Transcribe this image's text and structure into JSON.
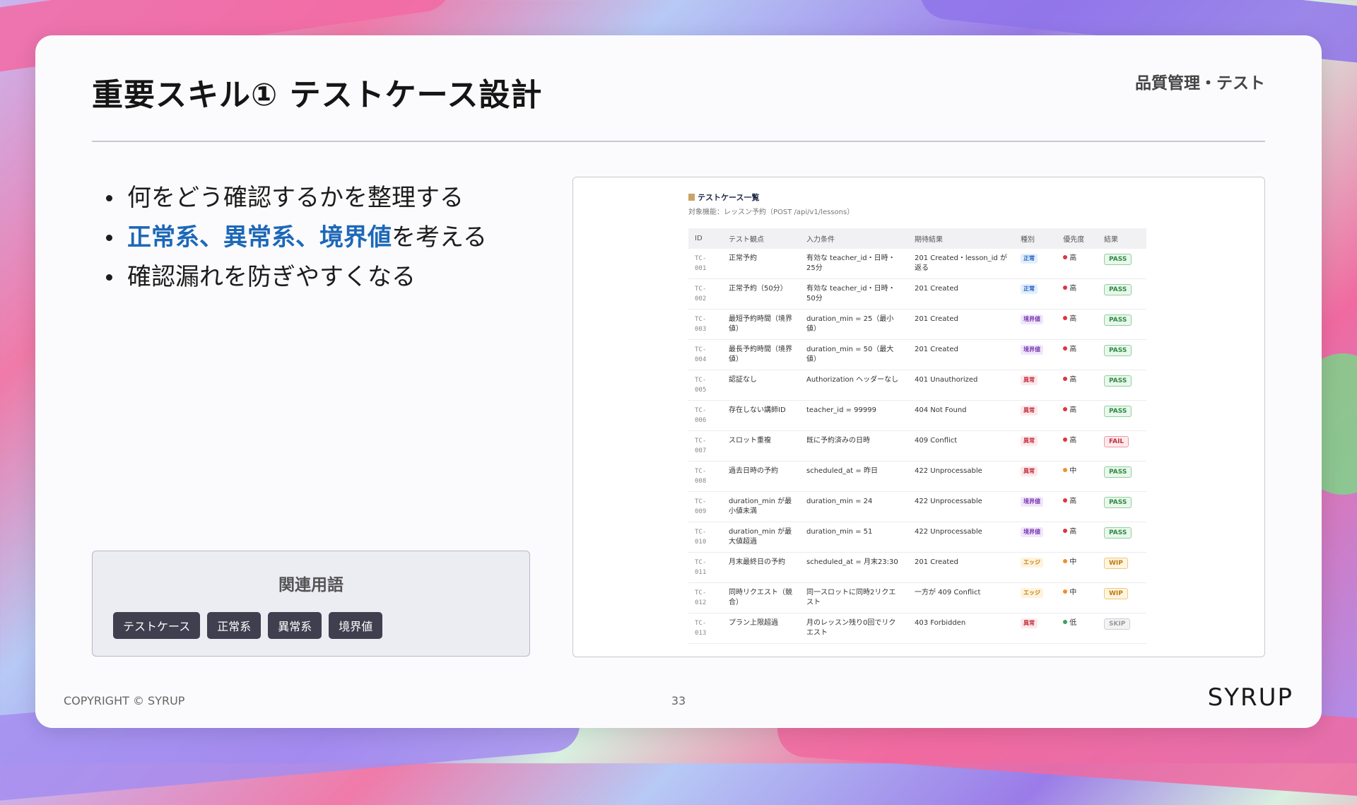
{
  "slide": {
    "title": "重要スキル① テストケース設計",
    "category": "品質管理・テスト",
    "bullets": [
      {
        "parts": [
          {
            "text": "何をどう確認するかを整理する",
            "hl": false
          }
        ]
      },
      {
        "parts": [
          {
            "text": "正常系、異常系、境界値",
            "hl": true
          },
          {
            "text": "を考える",
            "hl": false
          }
        ]
      },
      {
        "parts": [
          {
            "text": "確認漏れを防ぎやすくなる",
            "hl": false
          }
        ]
      }
    ],
    "related": {
      "title": "関連用語",
      "terms": [
        "テストケース",
        "正常系",
        "異常系",
        "境界値"
      ]
    },
    "footer": {
      "copyright": "COPYRIGHT © SYRUP",
      "page": "33",
      "logo": "SYRUP"
    }
  },
  "testcases": {
    "title": "テストケース一覧",
    "subtitle": "対象機能：レッスン予約（POST /api/v1/lessons）",
    "columns": [
      "ID",
      "テスト観点",
      "入力条件",
      "期待結果",
      "種別",
      "優先度",
      "結果"
    ],
    "rows": [
      {
        "id": "TC-001",
        "aspect": "正常予約",
        "input": "有効な teacher_id・日時・25分",
        "expected": "201 Created・lesson_id が返る",
        "type": "正常",
        "priority": "高",
        "result": "PASS"
      },
      {
        "id": "TC-002",
        "aspect": "正常予約（50分）",
        "input": "有効な teacher_id・日時・50分",
        "expected": "201 Created",
        "type": "正常",
        "priority": "高",
        "result": "PASS"
      },
      {
        "id": "TC-003",
        "aspect": "最短予約時間（境界値）",
        "input": "duration_min = 25（最小値）",
        "expected": "201 Created",
        "type": "境界値",
        "priority": "高",
        "result": "PASS"
      },
      {
        "id": "TC-004",
        "aspect": "最長予約時間（境界値）",
        "input": "duration_min = 50（最大値）",
        "expected": "201 Created",
        "type": "境界値",
        "priority": "高",
        "result": "PASS"
      },
      {
        "id": "TC-005",
        "aspect": "認証なし",
        "input": "Authorization ヘッダーなし",
        "expected": "401 Unauthorized",
        "type": "異常",
        "priority": "高",
        "result": "PASS"
      },
      {
        "id": "TC-006",
        "aspect": "存在しない講師ID",
        "input": "teacher_id = 99999",
        "expected": "404 Not Found",
        "type": "異常",
        "priority": "高",
        "result": "PASS"
      },
      {
        "id": "TC-007",
        "aspect": "スロット重複",
        "input": "既に予約済みの日時",
        "expected": "409 Conflict",
        "type": "異常",
        "priority": "高",
        "result": "FAIL"
      },
      {
        "id": "TC-008",
        "aspect": "過去日時の予約",
        "input": "scheduled_at = 昨日",
        "expected": "422 Unprocessable",
        "type": "異常",
        "priority": "中",
        "result": "PASS"
      },
      {
        "id": "TC-009",
        "aspect": "duration_min が最小値未満",
        "input": "duration_min = 24",
        "expected": "422 Unprocessable",
        "type": "境界値",
        "priority": "高",
        "result": "PASS"
      },
      {
        "id": "TC-010",
        "aspect": "duration_min が最大値超過",
        "input": "duration_min = 51",
        "expected": "422 Unprocessable",
        "type": "境界値",
        "priority": "高",
        "result": "PASS"
      },
      {
        "id": "TC-011",
        "aspect": "月末最終日の予約",
        "input": "scheduled_at = 月末23:30",
        "expected": "201 Created",
        "type": "エッジ",
        "priority": "中",
        "result": "WIP"
      },
      {
        "id": "TC-012",
        "aspect": "同時リクエスト（競合）",
        "input": "同一スロットに同時2リクエスト",
        "expected": "一方が 409 Conflict",
        "type": "エッジ",
        "priority": "中",
        "result": "WIP"
      },
      {
        "id": "TC-013",
        "aspect": "プラン上限超過",
        "input": "月のレッスン残り0回でリクエスト",
        "expected": "403 Forbidden",
        "type": "異常",
        "priority": "低",
        "result": "SKIP"
      }
    ]
  },
  "colors": {
    "highlight": "#1d68b8",
    "type": {
      "正常": {
        "bg": "#e3efff",
        "fg": "#1f5fbf"
      },
      "境界値": {
        "bg": "#f1e6fb",
        "fg": "#7a3bb0"
      },
      "異常": {
        "bg": "#fde8ea",
        "fg": "#c0303e"
      },
      "エッジ": {
        "bg": "#fff3dc",
        "fg": "#c07a10"
      }
    },
    "priority": {
      "高": "#e0343f",
      "中": "#f0902a",
      "低": "#3aa35a"
    },
    "result": {
      "PASS": {
        "bg": "#eaf7ec",
        "fg": "#2e8a43",
        "border": "#8fd19e"
      },
      "FAIL": {
        "bg": "#fdeaec",
        "fg": "#c0303e",
        "border": "#ef9aa3"
      },
      "WIP": {
        "bg": "#fff5e0",
        "fg": "#c07a10",
        "border": "#f2c77a"
      },
      "SKIP": {
        "bg": "#f3f3f5",
        "fg": "#999999",
        "border": "#cfcfd6"
      }
    }
  }
}
